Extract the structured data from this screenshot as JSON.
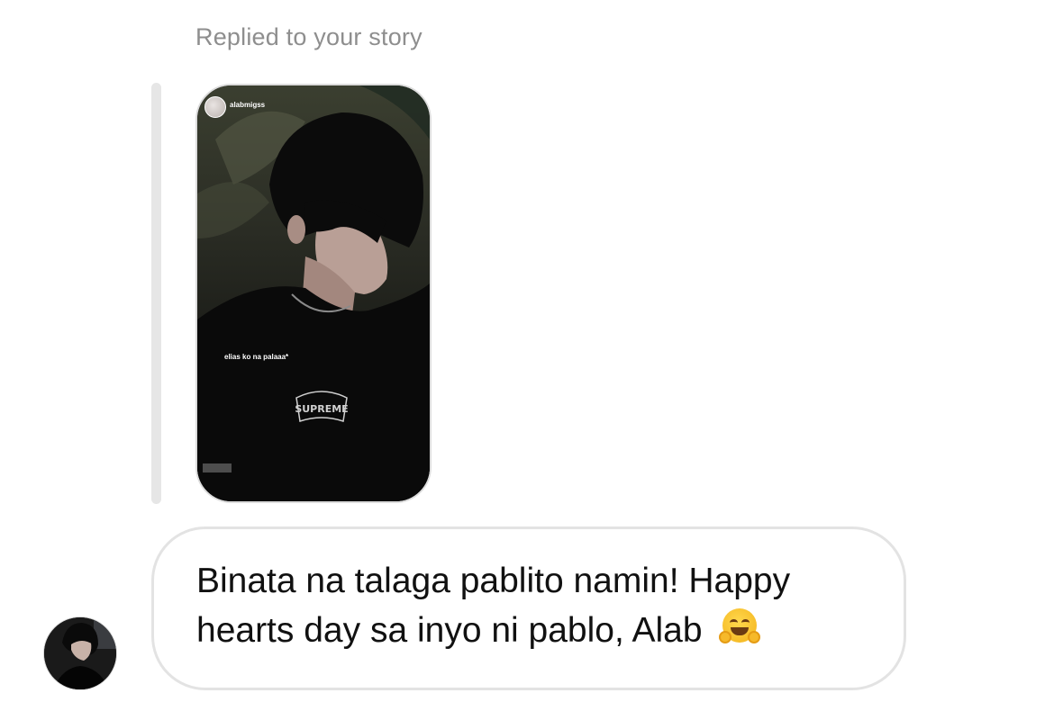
{
  "reply": {
    "label": "Replied to your story"
  },
  "story": {
    "username": "alabmigss",
    "caption": "elias ko na palaaa*"
  },
  "message": {
    "text": "Binata na talaga pablito namin! Happy hearts day sa inyo ni pablo, Alab",
    "emoji": "smiling-face-with-open-hands"
  },
  "colors": {
    "label_gray": "#8e8e8e",
    "bubble_border": "#e3e3e3",
    "quote_bar": "#e6e6e6",
    "text": "#111111"
  }
}
